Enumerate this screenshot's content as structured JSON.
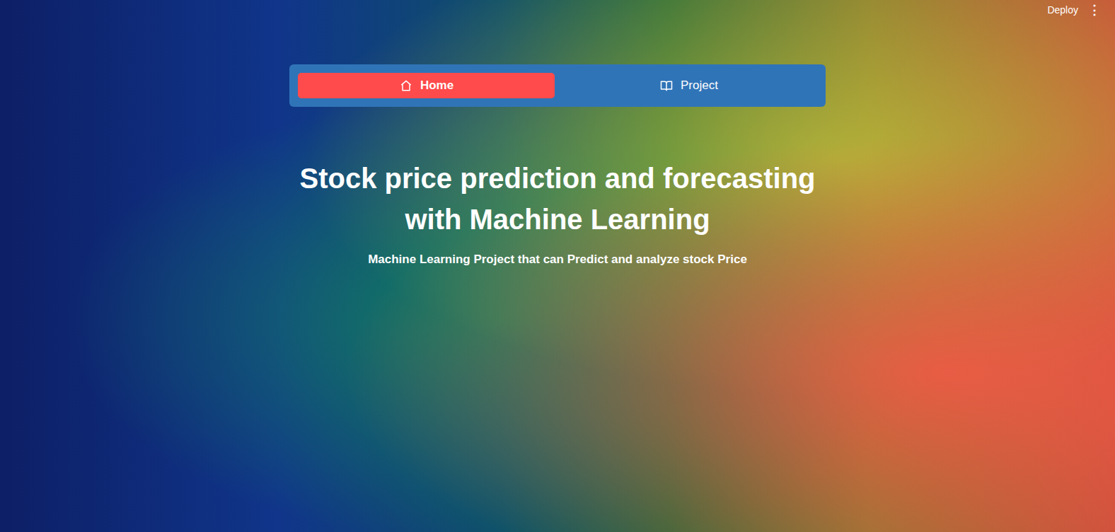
{
  "toolbar": {
    "deploy": "Deploy",
    "menu": "⋮"
  },
  "nav": {
    "tabs": [
      {
        "label": "Home",
        "icon": "home",
        "selected": true
      },
      {
        "label": "Project",
        "icon": "book",
        "selected": false
      }
    ]
  },
  "hero": {
    "title": "Stock price prediction and forecasting with Machine Learning",
    "subtitle": "Machine Learning Project that can Predict and analyze stock Price"
  }
}
